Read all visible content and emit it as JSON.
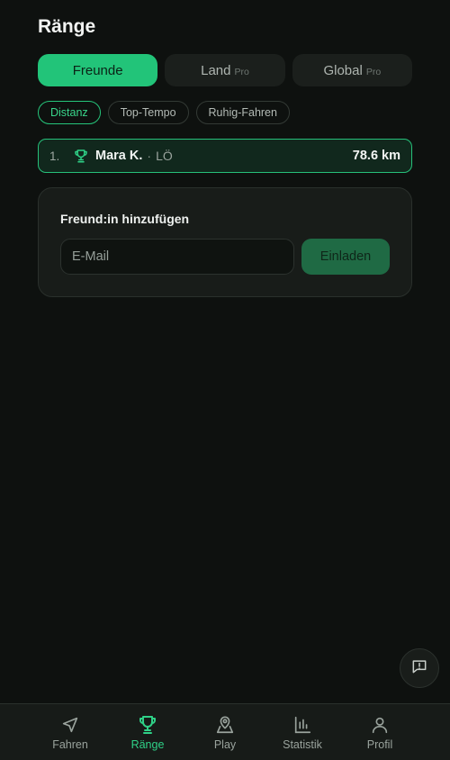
{
  "page": {
    "title": "Ränge"
  },
  "scope_tabs": [
    {
      "label": "Freunde",
      "badge": ""
    },
    {
      "label": "Land",
      "badge": "Pro"
    },
    {
      "label": "Global",
      "badge": "Pro"
    }
  ],
  "metric_chips": [
    {
      "label": "Distanz"
    },
    {
      "label": "Top-Tempo"
    },
    {
      "label": "Ruhig-Fahren"
    }
  ],
  "leaderboard": [
    {
      "rank": "1.",
      "name": "Mara K.",
      "separator": "·",
      "city": "LÖ",
      "distance": "78.6 km",
      "icon": "trophy-icon"
    }
  ],
  "add_friend": {
    "title": "Freund:in hinzufügen",
    "email_placeholder": "E-Mail",
    "email_value": "",
    "invite_label": "Einladen"
  },
  "fab": {
    "icon": "feedback-icon"
  },
  "bottom_nav": [
    {
      "label": "Fahren",
      "icon": "navigation-arrow-icon"
    },
    {
      "label": "Ränge",
      "icon": "trophy-icon"
    },
    {
      "label": "Play",
      "icon": "map-pin-icon"
    },
    {
      "label": "Statistik",
      "icon": "bar-chart-icon"
    },
    {
      "label": "Profil",
      "icon": "user-icon"
    }
  ],
  "colors": {
    "background": "#0e110f",
    "accent": "#22c479",
    "accent_text": "#2fd187",
    "surface": "#181c19",
    "invite_button": "#1f6a44"
  },
  "state": {
    "active_scope": "Freunde",
    "active_metric": "Distanz",
    "active_nav": "Ränge"
  }
}
